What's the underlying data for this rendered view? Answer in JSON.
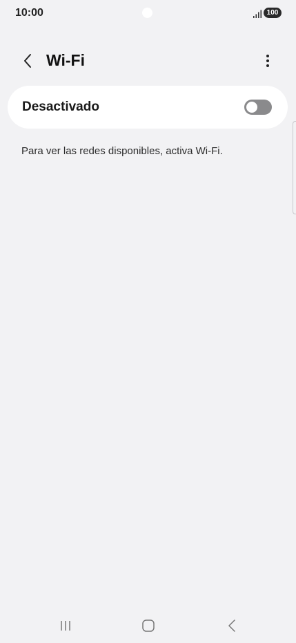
{
  "status_bar": {
    "time": "10:00",
    "battery": "100",
    "signal_icon": "signal-bars-icon"
  },
  "header": {
    "title": "Wi-Fi",
    "back_icon": "chevron-left-icon",
    "more_icon": "more-vertical-icon"
  },
  "wifi_toggle": {
    "label": "Desactivado",
    "state": "off"
  },
  "hint": "Para ver las redes disponibles, activa Wi-Fi.",
  "nav_bar": {
    "recents_icon": "recents-icon",
    "home_icon": "home-icon",
    "back_icon": "back-icon"
  },
  "colors": {
    "background": "#f2f2f4",
    "card": "#ffffff",
    "switch_off": "#8a8a8c"
  }
}
